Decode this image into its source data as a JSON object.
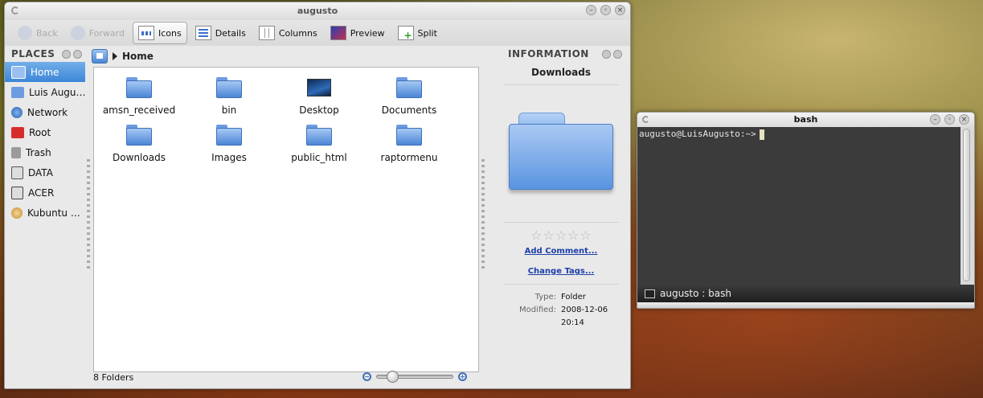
{
  "dolphin": {
    "title": "augusto",
    "toolbar": {
      "back": "Back",
      "forward": "Forward",
      "icons": "Icons",
      "details": "Details",
      "columns": "Columns",
      "preview": "Preview",
      "split": "Split"
    },
    "places": {
      "header": "PLACES",
      "items": [
        {
          "label": "Home",
          "icon": "home-icon",
          "color": "#5b8fd8"
        },
        {
          "label": "Luis Augu…",
          "icon": "folder-icon",
          "color": "#6c9be0"
        },
        {
          "label": "Network",
          "icon": "globe-icon",
          "color": "#3a74c8"
        },
        {
          "label": "Root",
          "icon": "red-folder-icon",
          "color": "#d82c2c"
        },
        {
          "label": "Trash",
          "icon": "trash-icon",
          "color": "#8a8a8a"
        },
        {
          "label": "DATA",
          "icon": "hard-drive-icon",
          "color": "#666666"
        },
        {
          "label": "ACER",
          "icon": "hard-drive-icon",
          "color": "#555555"
        },
        {
          "label": "Kubuntu …",
          "icon": "disc-icon",
          "color": "#d69a3c"
        }
      ]
    },
    "breadcrumb": {
      "current": "Home"
    },
    "files": [
      {
        "label": "amsn_received",
        "type": "folder"
      },
      {
        "label": "bin",
        "type": "folder"
      },
      {
        "label": "Desktop",
        "type": "desktop"
      },
      {
        "label": "Documents",
        "type": "folder"
      },
      {
        "label": "Downloads",
        "type": "folder"
      },
      {
        "label": "Images",
        "type": "folder"
      },
      {
        "label": "public_html",
        "type": "folder"
      },
      {
        "label": "raptormenu",
        "type": "folder"
      }
    ],
    "status": "8 Folders",
    "zoom_level": 0.15,
    "info": {
      "header": "INFORMATION",
      "name": "Downloads",
      "rating": 0,
      "add_comment": "Add Comment...",
      "change_tags": "Change Tags...",
      "type_label": "Type:",
      "type_value": "Folder",
      "modified_label": "Modified:",
      "modified_value": "2008-12-06 20:14"
    }
  },
  "konsole": {
    "title": "bash",
    "prompt": "augusto@LuisAugusto:~>",
    "tab_label": "augusto : bash"
  }
}
